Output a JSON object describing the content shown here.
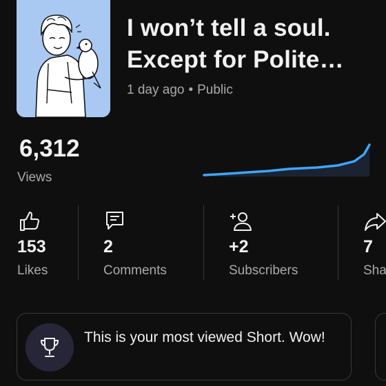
{
  "video": {
    "title_line1": "I won’t tell a soul.",
    "title_line2": "Except for Polite…",
    "age": "1 day ago",
    "separator": "•",
    "visibility": "Public"
  },
  "views": {
    "count": "6,312",
    "label": "Views"
  },
  "stats": [
    {
      "value": "153",
      "label": "Likes",
      "icon": "thumbs-up-icon"
    },
    {
      "value": "2",
      "label": "Comments",
      "icon": "comment-icon"
    },
    {
      "value": "+2",
      "label": "Subscribers",
      "icon": "add-person-icon"
    },
    {
      "value": "7",
      "label": "Sha",
      "icon": "share-icon"
    }
  ],
  "insight": {
    "text": "This is your most viewed Short. Wow!",
    "icon": "trophy-icon"
  },
  "colors": {
    "accent": "#3ea6ff",
    "background": "#0f0f0f",
    "thumbnail_bg": "#a9c9f2"
  }
}
